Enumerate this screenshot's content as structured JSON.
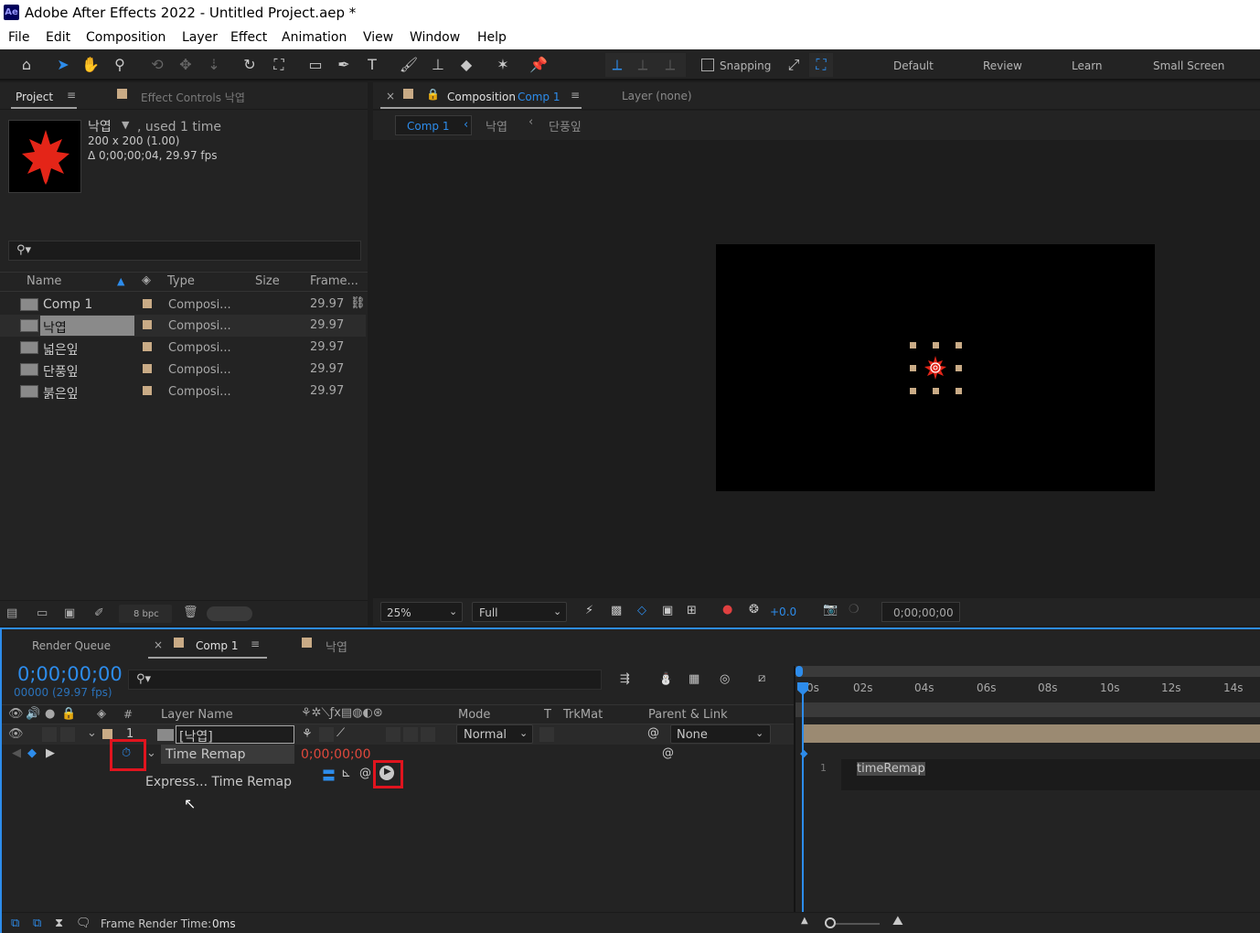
{
  "window": {
    "title": "Adobe After Effects 2022 - Untitled Project.aep *",
    "logo": "Ae"
  },
  "menu": [
    "File",
    "Edit",
    "Composition",
    "Layer",
    "Effect",
    "Animation",
    "View",
    "Window",
    "Help"
  ],
  "toolbar": {
    "snapping_label": "Snapping",
    "workspaces": [
      "Default",
      "Review",
      "Learn",
      "Small Screen"
    ]
  },
  "project_panel": {
    "tab_project": "Project",
    "tab_effect_controls": "Effect Controls 낙엽",
    "selected_item": {
      "name": "낙엽",
      "usage": ", used 1 time",
      "dims": "200 x 200 (1.00)",
      "duration": "Δ 0;00;00;04, 29.97 fps"
    },
    "search_placeholder": "",
    "columns": {
      "name": "Name",
      "type": "Type",
      "size": "Size",
      "frame": "Frame..."
    },
    "items": [
      {
        "name": "Comp 1",
        "type": "Composi...",
        "frame": "29.97"
      },
      {
        "name": "낙엽",
        "type": "Composi...",
        "frame": "29.97"
      },
      {
        "name": "넓은잎",
        "type": "Composi...",
        "frame": "29.97"
      },
      {
        "name": "단풍잎",
        "type": "Composi...",
        "frame": "29.97"
      },
      {
        "name": "붉은잎",
        "type": "Composi...",
        "frame": "29.97"
      }
    ],
    "bpc": "8 bpc"
  },
  "comp_panel": {
    "tab_label": "Composition",
    "tab_comp_name": "Comp 1",
    "layer_tab": "Layer (none)",
    "breadcrumbs": [
      "Comp 1",
      "낙엽",
      "단풍잎"
    ],
    "zoom": "25%",
    "resolution": "Full",
    "exposure": "+0.0",
    "timecode": "0;00;00;00"
  },
  "timeline": {
    "tab_render_queue": "Render Queue",
    "tab_comp": "Comp 1",
    "tab_other": "낙엽",
    "current_time": "0;00;00;00",
    "frame_info": "00000 (29.97 fps)",
    "columns": {
      "num": "#",
      "layer_name": "Layer Name",
      "mode": "Mode",
      "t": "T",
      "trkmat": "TrkMat",
      "parent": "Parent & Link"
    },
    "layer": {
      "index": "1",
      "name": "[낙엽]",
      "mode": "Normal",
      "parent": "None"
    },
    "property": {
      "name": "Time Remap",
      "value": "0;00;00;00"
    },
    "expression": {
      "label": "Express... Time Remap",
      "line_number": "1",
      "code": "timeRemap"
    },
    "ruler_ticks": [
      "0s",
      "02s",
      "04s",
      "06s",
      "08s",
      "10s",
      "12s",
      "14s"
    ],
    "footer": {
      "label": "Frame Render Time:",
      "value": "0ms"
    }
  },
  "colors": {
    "accent": "#2d8ceb",
    "label_tan": "#c9ab86",
    "highlight_red": "#e0141e",
    "timecode_red": "#e0483c"
  }
}
